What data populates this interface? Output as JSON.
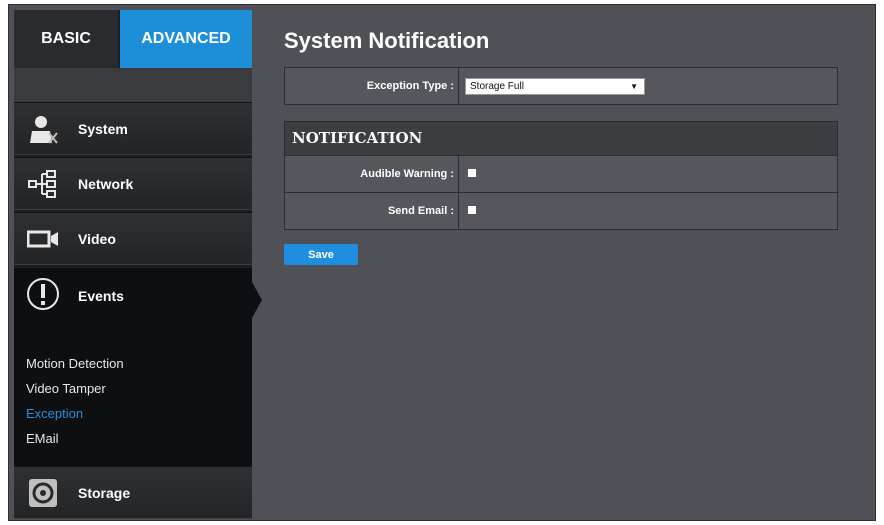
{
  "tabs": {
    "basic": "BASIC",
    "advanced": "ADVANCED"
  },
  "sidebar": {
    "system": "System",
    "network": "Network",
    "video": "Video",
    "events": "Events",
    "events_sub": [
      "Motion Detection",
      "Video Tamper",
      "Exception",
      "EMail"
    ],
    "active_sub": "Exception",
    "storage": "Storage"
  },
  "page": {
    "title": "System Notification"
  },
  "exception": {
    "label": "Exception Type :",
    "value": "Storage Full"
  },
  "notification": {
    "heading": "NOTIFICATION",
    "audible_label": "Audible Warning :",
    "email_label": "Send Email :"
  },
  "buttons": {
    "save": "Save"
  },
  "colors": {
    "accent": "#1c8fd8",
    "panel": "#4f5156",
    "sidebar": "#1c1d1f"
  }
}
